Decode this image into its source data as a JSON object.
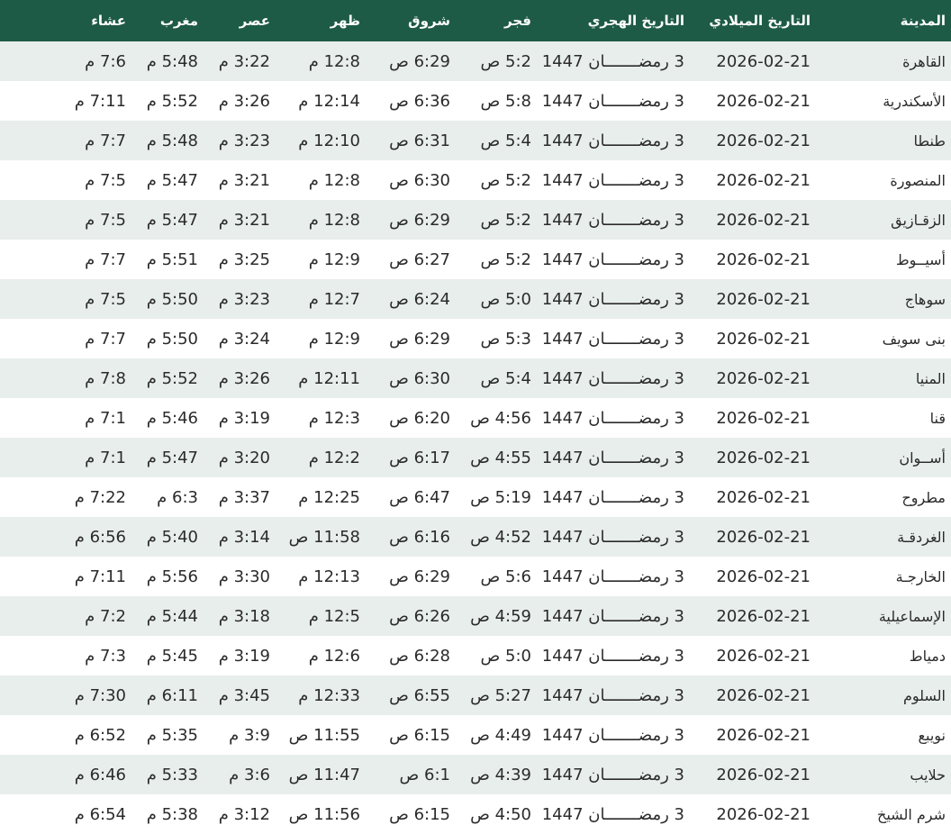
{
  "headers": {
    "city": "المدينة",
    "gregorian": "التاريخ الميلادي",
    "hijri": "التاريخ الهجري",
    "fajr": "فجر",
    "shuruq": "شروق",
    "dhuhr": "ظهر",
    "asr": "عصر",
    "maghrib": "مغرب",
    "isha": "عشاء"
  },
  "rows": [
    {
      "city": "القاهرة",
      "gregorian": "2026-02-21",
      "hijri": "3 رمضـــــــان 1447",
      "fajr": "5:2 ص",
      "shuruq": "6:29 ص",
      "dhuhr": "12:8 م",
      "asr": "3:22 م",
      "maghrib": "5:48 م",
      "isha": "7:6 م"
    },
    {
      "city": "الأسكندرية",
      "gregorian": "2026-02-21",
      "hijri": "3 رمضـــــــان 1447",
      "fajr": "5:8 ص",
      "shuruq": "6:36 ص",
      "dhuhr": "12:14 م",
      "asr": "3:26 م",
      "maghrib": "5:52 م",
      "isha": "7:11 م"
    },
    {
      "city": "طنطا",
      "gregorian": "2026-02-21",
      "hijri": "3 رمضـــــــان 1447",
      "fajr": "5:4 ص",
      "shuruq": "6:31 ص",
      "dhuhr": "12:10 م",
      "asr": "3:23 م",
      "maghrib": "5:48 م",
      "isha": "7:7 م"
    },
    {
      "city": "المنصورة",
      "gregorian": "2026-02-21",
      "hijri": "3 رمضـــــــان 1447",
      "fajr": "5:2 ص",
      "shuruq": "6:30 ص",
      "dhuhr": "12:8 م",
      "asr": "3:21 م",
      "maghrib": "5:47 م",
      "isha": "7:5 م"
    },
    {
      "city": "الزقـازيق",
      "gregorian": "2026-02-21",
      "hijri": "3 رمضـــــــان 1447",
      "fajr": "5:2 ص",
      "shuruq": "6:29 ص",
      "dhuhr": "12:8 م",
      "asr": "3:21 م",
      "maghrib": "5:47 م",
      "isha": "7:5 م"
    },
    {
      "city": "أسيــوط",
      "gregorian": "2026-02-21",
      "hijri": "3 رمضـــــــان 1447",
      "fajr": "5:2 ص",
      "shuruq": "6:27 ص",
      "dhuhr": "12:9 م",
      "asr": "3:25 م",
      "maghrib": "5:51 م",
      "isha": "7:7 م"
    },
    {
      "city": "سوهاج",
      "gregorian": "2026-02-21",
      "hijri": "3 رمضـــــــان 1447",
      "fajr": "5:0 ص",
      "shuruq": "6:24 ص",
      "dhuhr": "12:7 م",
      "asr": "3:23 م",
      "maghrib": "5:50 م",
      "isha": "7:5 م"
    },
    {
      "city": "بنى سويف",
      "gregorian": "2026-02-21",
      "hijri": "3 رمضـــــــان 1447",
      "fajr": "5:3 ص",
      "shuruq": "6:29 ص",
      "dhuhr": "12:9 م",
      "asr": "3:24 م",
      "maghrib": "5:50 م",
      "isha": "7:7 م"
    },
    {
      "city": "المنيا",
      "gregorian": "2026-02-21",
      "hijri": "3 رمضـــــــان 1447",
      "fajr": "5:4 ص",
      "shuruq": "6:30 ص",
      "dhuhr": "12:11 م",
      "asr": "3:26 م",
      "maghrib": "5:52 م",
      "isha": "7:8 م"
    },
    {
      "city": "قنا",
      "gregorian": "2026-02-21",
      "hijri": "3 رمضـــــــان 1447",
      "fajr": "4:56 ص",
      "shuruq": "6:20 ص",
      "dhuhr": "12:3 م",
      "asr": "3:19 م",
      "maghrib": "5:46 م",
      "isha": "7:1 م"
    },
    {
      "city": "أســوان",
      "gregorian": "2026-02-21",
      "hijri": "3 رمضـــــــان 1447",
      "fajr": "4:55 ص",
      "shuruq": "6:17 ص",
      "dhuhr": "12:2 م",
      "asr": "3:20 م",
      "maghrib": "5:47 م",
      "isha": "7:1 م"
    },
    {
      "city": "مطروح",
      "gregorian": "2026-02-21",
      "hijri": "3 رمضـــــــان 1447",
      "fajr": "5:19 ص",
      "shuruq": "6:47 ص",
      "dhuhr": "12:25 م",
      "asr": "3:37 م",
      "maghrib": "6:3 م",
      "isha": "7:22 م"
    },
    {
      "city": "الغردقـة",
      "gregorian": "2026-02-21",
      "hijri": "3 رمضـــــــان 1447",
      "fajr": "4:52 ص",
      "shuruq": "6:16 ص",
      "dhuhr": "11:58 ص",
      "asr": "3:14 م",
      "maghrib": "5:40 م",
      "isha": "6:56 م"
    },
    {
      "city": "الخارجـة",
      "gregorian": "2026-02-21",
      "hijri": "3 رمضـــــــان 1447",
      "fajr": "5:6 ص",
      "shuruq": "6:29 ص",
      "dhuhr": "12:13 م",
      "asr": "3:30 م",
      "maghrib": "5:56 م",
      "isha": "7:11 م"
    },
    {
      "city": "الإسماعيلية",
      "gregorian": "2026-02-21",
      "hijri": "3 رمضـــــــان 1447",
      "fajr": "4:59 ص",
      "shuruq": "6:26 ص",
      "dhuhr": "12:5 م",
      "asr": "3:18 م",
      "maghrib": "5:44 م",
      "isha": "7:2 م"
    },
    {
      "city": "دمياط",
      "gregorian": "2026-02-21",
      "hijri": "3 رمضـــــــان 1447",
      "fajr": "5:0 ص",
      "shuruq": "6:28 ص",
      "dhuhr": "12:6 م",
      "asr": "3:19 م",
      "maghrib": "5:45 م",
      "isha": "7:3 م"
    },
    {
      "city": "السلوم",
      "gregorian": "2026-02-21",
      "hijri": "3 رمضـــــــان 1447",
      "fajr": "5:27 ص",
      "shuruq": "6:55 ص",
      "dhuhr": "12:33 م",
      "asr": "3:45 م",
      "maghrib": "6:11 م",
      "isha": "7:30 م"
    },
    {
      "city": "نويبع",
      "gregorian": "2026-02-21",
      "hijri": "3 رمضـــــــان 1447",
      "fajr": "4:49 ص",
      "shuruq": "6:15 ص",
      "dhuhr": "11:55 ص",
      "asr": "3:9 م",
      "maghrib": "5:35 م",
      "isha": "6:52 م"
    },
    {
      "city": "حلايب",
      "gregorian": "2026-02-21",
      "hijri": "3 رمضـــــــان 1447",
      "fajr": "4:39 ص",
      "shuruq": "6:1 ص",
      "dhuhr": "11:47 ص",
      "asr": "3:6 م",
      "maghrib": "5:33 م",
      "isha": "6:46 م"
    },
    {
      "city": "شرم الشيخ",
      "gregorian": "2026-02-21",
      "hijri": "3 رمضـــــــان 1447",
      "fajr": "4:50 ص",
      "shuruq": "6:15 ص",
      "dhuhr": "11:56 ص",
      "asr": "3:12 م",
      "maghrib": "5:38 م",
      "isha": "6:54 م"
    }
  ]
}
